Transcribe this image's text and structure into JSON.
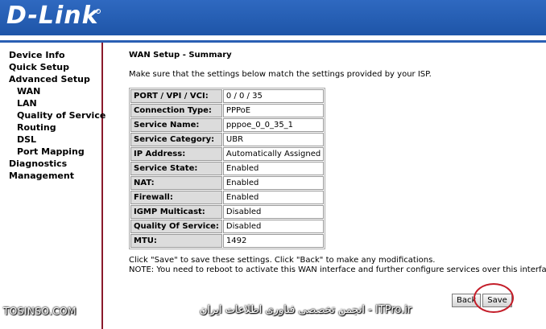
{
  "brand": {
    "logo_text": "D-Link"
  },
  "sidebar": {
    "items": [
      {
        "label": "Device Info",
        "level": 0
      },
      {
        "label": "Quick Setup",
        "level": 0
      },
      {
        "label": "Advanced Setup",
        "level": 0
      },
      {
        "label": "WAN",
        "level": 1
      },
      {
        "label": "LAN",
        "level": 1
      },
      {
        "label": "Quality of Service",
        "level": 1
      },
      {
        "label": "Routing",
        "level": 1
      },
      {
        "label": "DSL",
        "level": 1
      },
      {
        "label": "Port Mapping",
        "level": 1
      },
      {
        "label": "Diagnostics",
        "level": 0
      },
      {
        "label": "Management",
        "level": 0
      }
    ]
  },
  "main": {
    "title": "WAN Setup - Summary",
    "intro": "Make sure that the settings below match the settings provided by your ISP.",
    "summary_rows": [
      {
        "key": "PORT / VPI / VCI:",
        "value": "0 / 0 / 35"
      },
      {
        "key": "Connection Type:",
        "value": "PPPoE"
      },
      {
        "key": "Service Name:",
        "value": "pppoe_0_0_35_1"
      },
      {
        "key": "Service Category:",
        "value": "UBR"
      },
      {
        "key": "IP Address:",
        "value": "Automatically Assigned"
      },
      {
        "key": "Service State:",
        "value": "Enabled"
      },
      {
        "key": "NAT:",
        "value": "Enabled"
      },
      {
        "key": "Firewall:",
        "value": "Enabled"
      },
      {
        "key": "IGMP Multicast:",
        "value": "Disabled"
      },
      {
        "key": "Quality Of Service:",
        "value": "Disabled"
      },
      {
        "key": "MTU:",
        "value": "1492"
      }
    ],
    "note_save": "Click \"Save\" to save these settings. Click \"Back\" to make any modifications.",
    "note_reboot": "NOTE: You need to reboot to activate this WAN interface and further configure services over this interface."
  },
  "actions": {
    "back_label": "Back",
    "save_label": "Save"
  },
  "watermarks": {
    "left": "TOSINSO.COM",
    "right": "ITPro.ir - انجمن تخصصی فناوری اطلاعات ایران"
  },
  "colors": {
    "header_blue": "#2a5fb4",
    "sidebar_border": "#8a1a2c",
    "highlight_red": "#c41e2a"
  }
}
